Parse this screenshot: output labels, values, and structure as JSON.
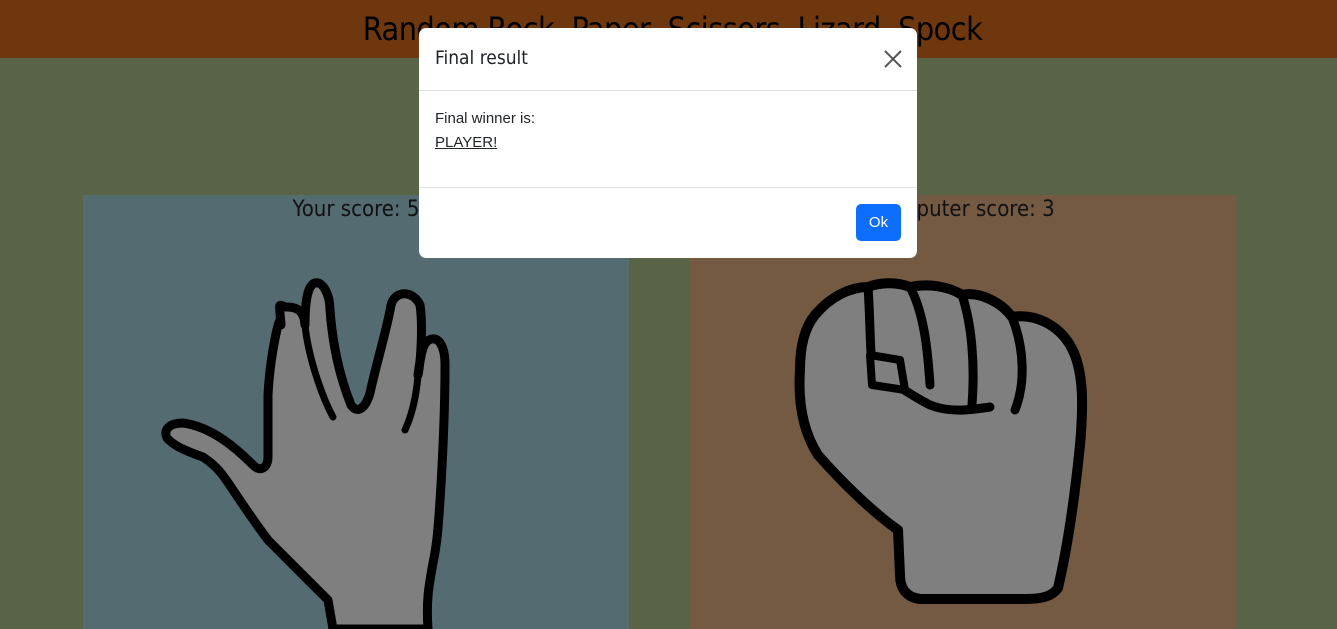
{
  "app": {
    "title": "Random Rock, Paper, Scissors, Lizard, Spock"
  },
  "player": {
    "score_label": "Your score: 5",
    "choice_icon": "spock-hand-icon"
  },
  "computer": {
    "score_label": "Computer score: 3",
    "choice_icon": "rock-fist-icon"
  },
  "modal": {
    "title": "Final result",
    "close_icon": "close-icon",
    "winner_label": "Final winner is:",
    "winner_name": "PLAYER!",
    "ok_label": "Ok"
  },
  "colors": {
    "header": "#dc6e1d",
    "background": "#b3c98d",
    "player_panel": "#a9d7e5",
    "computer_panel": "#e9b584",
    "primary_button": "#0d6efd",
    "hand_fill": "#ffffff"
  }
}
